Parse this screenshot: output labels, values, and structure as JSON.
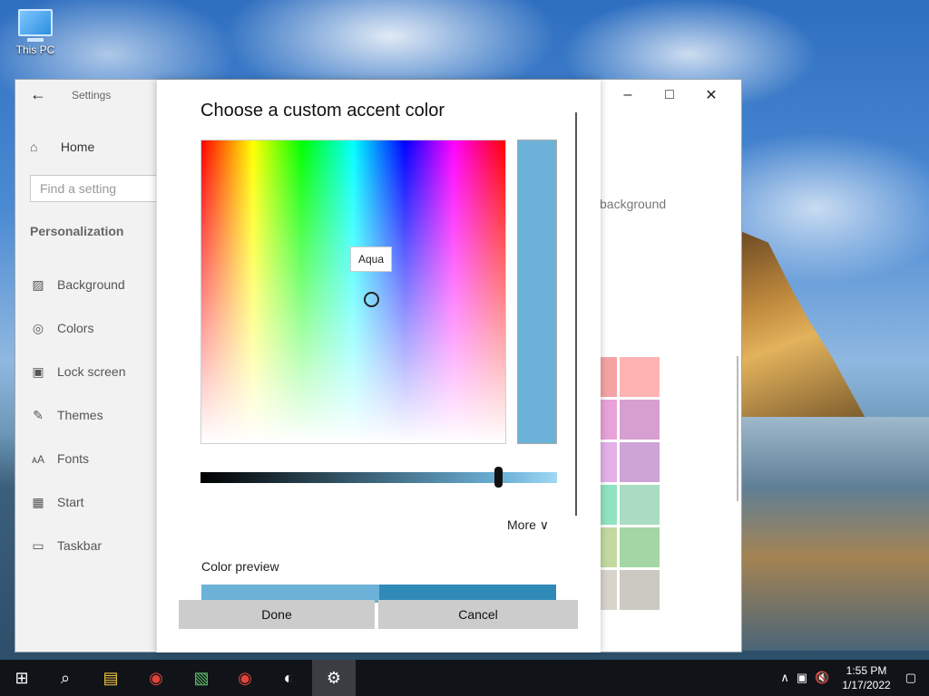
{
  "desktop": {
    "icon_label": "This PC"
  },
  "settings": {
    "window_title": "Settings",
    "home_label": "Home",
    "search_placeholder": "Find a setting",
    "section_title": "Personalization",
    "nav": [
      {
        "label": "Background",
        "icon": "picture-icon"
      },
      {
        "label": "Colors",
        "icon": "palette-icon"
      },
      {
        "label": "Lock screen",
        "icon": "lock-screen-icon"
      },
      {
        "label": "Themes",
        "icon": "themes-icon"
      },
      {
        "label": "Fonts",
        "icon": "fonts-icon"
      },
      {
        "label": "Start",
        "icon": "start-icon"
      },
      {
        "label": "Taskbar",
        "icon": "taskbar-icon"
      }
    ],
    "content_partial_text": "background",
    "swatch_colors": [
      "#f3a3a3",
      "#ffb3b3",
      "#e8a3d8",
      "#d69fd0",
      "#e3b0e8",
      "#cea3d6",
      "#8fe3c0",
      "#a9dcc0",
      "#c3d9a0",
      "#a3d6a3",
      "#d8d4cc",
      "#ccc8c2"
    ]
  },
  "dialog": {
    "title": "Choose a custom accent color",
    "hover_tooltip": "Aqua",
    "selected_color": "#6cb2d8",
    "more_label": "More",
    "preview_label": "Color preview",
    "preview_colors": [
      "#6cb2d8",
      "#2f8ab8"
    ],
    "done_label": "Done",
    "cancel_label": "Cancel"
  },
  "taskbar": {
    "time": "1:55 PM",
    "date": "1/17/2022"
  }
}
